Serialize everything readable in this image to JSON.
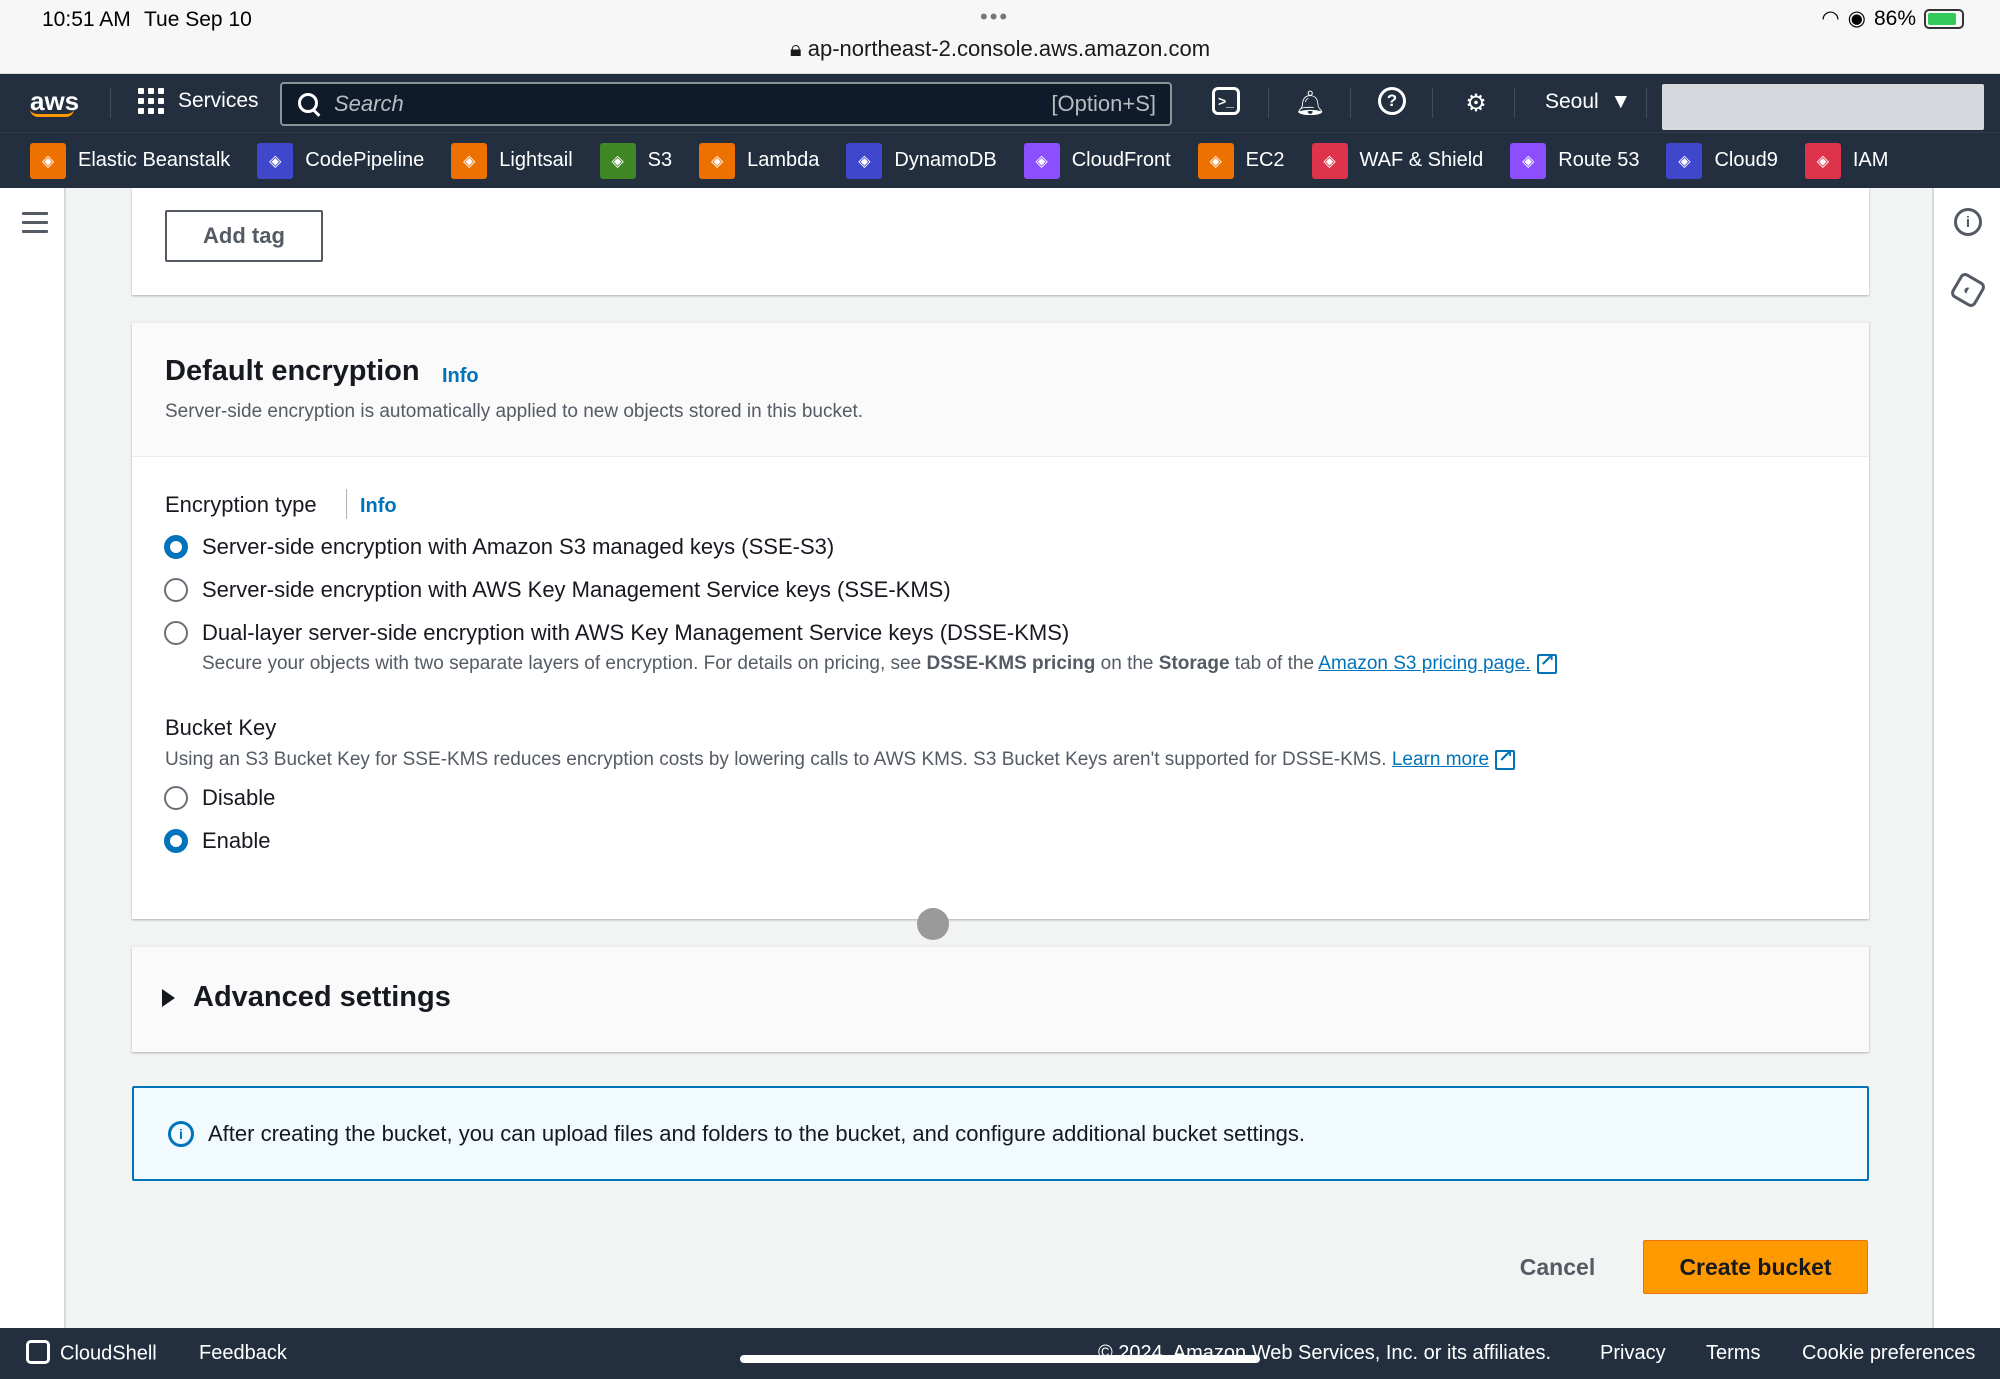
{
  "status_bar": {
    "time": "10:51 AM",
    "date": "Tue Sep 10",
    "battery": "86%",
    "url": "ap-northeast-2.console.aws.amazon.com"
  },
  "nav": {
    "logo": "aws",
    "services_label": "Services",
    "search_placeholder": "Search",
    "search_shortcut": "[Option+S]",
    "region": "Seoul"
  },
  "favorites": [
    {
      "label": "Elastic Beanstalk",
      "color": "#ed7100"
    },
    {
      "label": "CodePipeline",
      "color": "#3f48cc"
    },
    {
      "label": "Lightsail",
      "color": "#ed7100"
    },
    {
      "label": "S3",
      "color": "#3f8624"
    },
    {
      "label": "Lambda",
      "color": "#ed7100"
    },
    {
      "label": "DynamoDB",
      "color": "#3f48cc"
    },
    {
      "label": "CloudFront",
      "color": "#8c4fff"
    },
    {
      "label": "EC2",
      "color": "#ed7100"
    },
    {
      "label": "WAF & Shield",
      "color": "#dd344c"
    },
    {
      "label": "Route 53",
      "color": "#8c4fff"
    },
    {
      "label": "Cloud9",
      "color": "#3f48cc"
    },
    {
      "label": "IAM",
      "color": "#dd344c"
    }
  ],
  "tags": {
    "add_tag_label": "Add tag"
  },
  "encryption": {
    "title": "Default encryption",
    "info": "Info",
    "description": "Server-side encryption is automatically applied to new objects stored in this bucket.",
    "type_label": "Encryption type",
    "type_info": "Info",
    "options": [
      {
        "label": "Server-side encryption with Amazon S3 managed keys (SSE-S3)",
        "selected": true
      },
      {
        "label": "Server-side encryption with AWS Key Management Service keys (SSE-KMS)",
        "selected": false
      },
      {
        "label": "Dual-layer server-side encryption with AWS Key Management Service keys (DSSE-KMS)",
        "selected": false
      }
    ],
    "dsse_desc_1": "Secure your objects with two separate layers of encryption. For details on pricing, see ",
    "dsse_desc_bold_1": "DSSE-KMS pricing",
    "dsse_desc_2": " on the ",
    "dsse_desc_bold_2": "Storage",
    "dsse_desc_3": " tab of the ",
    "dsse_link": "Amazon S3 pricing page.",
    "bucket_key_label": "Bucket Key",
    "bucket_key_desc": "Using an S3 Bucket Key for SSE-KMS reduces encryption costs by lowering calls to AWS KMS. S3 Bucket Keys aren't supported for DSSE-KMS. ",
    "learn_more": "Learn more",
    "bucket_key_options": [
      {
        "label": "Disable",
        "selected": false
      },
      {
        "label": "Enable",
        "selected": true
      }
    ]
  },
  "advanced": {
    "title": "Advanced settings"
  },
  "alert": {
    "text": "After creating the bucket, you can upload files and folders to the bucket, and configure additional bucket settings."
  },
  "actions": {
    "cancel": "Cancel",
    "create": "Create bucket"
  },
  "footer": {
    "cloudshell": "CloudShell",
    "feedback": "Feedback",
    "copyright": "© 2024, Amazon Web Services, Inc. or its affiliates.",
    "privacy": "Privacy",
    "terms": "Terms",
    "cookies": "Cookie preferences"
  },
  "colors": {
    "nav_bg": "#232f3e",
    "accent_orange": "#ff9900",
    "link_blue": "#0073bb"
  }
}
